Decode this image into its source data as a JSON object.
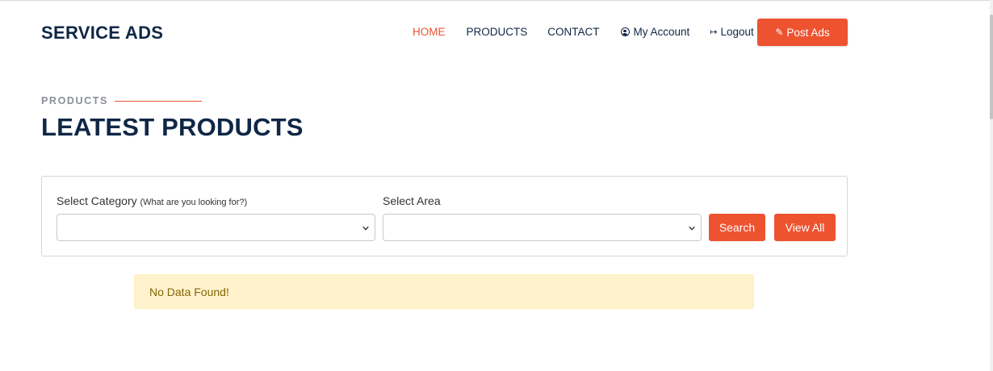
{
  "header": {
    "brand": "SERVICE ADS",
    "nav": [
      {
        "label": "HOME",
        "active": true
      },
      {
        "label": "PRODUCTS",
        "active": false
      },
      {
        "label": "CONTACT",
        "active": false
      },
      {
        "label": "My Account",
        "icon": "user-circle-icon"
      },
      {
        "label": "Logout",
        "icon": "sign-out-icon"
      }
    ],
    "post_button": {
      "label": "Post Ads",
      "icon": "edit-icon"
    }
  },
  "section": {
    "eyebrow": "PRODUCTS",
    "title": "LEATEST PRODUCTS"
  },
  "filters": {
    "category_label": "Select Category",
    "category_hint": "(What are you looking for?)",
    "category_value": "",
    "area_label": "Select Area",
    "area_value": "",
    "search_label": "Search",
    "view_all_label": "View All"
  },
  "alert": {
    "message": "No Data Found!"
  },
  "colors": {
    "accent": "#ee5330",
    "navy": "#0f2746",
    "alert_bg": "#fff3cd",
    "alert_text": "#856404"
  }
}
